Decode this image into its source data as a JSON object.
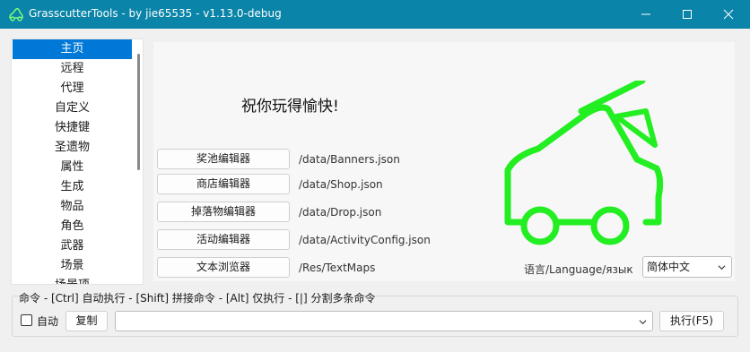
{
  "window": {
    "title": "GrasscutterTools  - by jie65535  - v1.13.0-debug",
    "accent": "#0a84a8"
  },
  "sidebar": {
    "items": [
      {
        "label": "主页",
        "active": true
      },
      {
        "label": "远程"
      },
      {
        "label": "代理"
      },
      {
        "label": "自定义"
      },
      {
        "label": "快捷键"
      },
      {
        "label": "圣遗物"
      },
      {
        "label": "属性"
      },
      {
        "label": "生成"
      },
      {
        "label": "物品"
      },
      {
        "label": "角色"
      },
      {
        "label": "武器"
      },
      {
        "label": "场景"
      },
      {
        "label": "场景项"
      }
    ]
  },
  "home": {
    "welcome": "祝你玩得愉快!",
    "tools": [
      {
        "button": "奖池编辑器",
        "path": "/data/Banners.json"
      },
      {
        "button": "商店编辑器",
        "path": "/data/Shop.json"
      },
      {
        "button": "掉落物编辑器",
        "path": "/data/Drop.json"
      },
      {
        "button": "活动编辑器",
        "path": "/data/ActivityConfig.json"
      },
      {
        "button": "文本浏览器",
        "path": "/Res/TextMaps"
      }
    ],
    "language_label": "语言/Language/язык",
    "language_value": "简体中文",
    "logo_color": "#22ee22"
  },
  "command": {
    "hint": "命令 - [Ctrl] 自动执行 - [Shift] 拼接命令 - [Alt] 仅执行 - [|] 分割多条命令",
    "auto_label": "自动",
    "copy_label": "复制",
    "input_value": "",
    "execute_label": "执行(F5)"
  }
}
